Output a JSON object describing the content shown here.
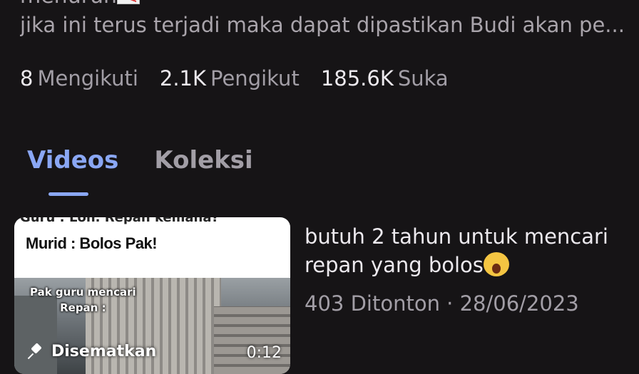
{
  "bio": {
    "line_partial": "menurun",
    "line2": "jika ini terus terjadi maka dapat dipastikan Budi akan pe..."
  },
  "stats": [
    {
      "num": "8",
      "label": "Mengikuti"
    },
    {
      "num": "2.1K",
      "label": "Pengikut"
    },
    {
      "num": "185.6K",
      "label": "Suka"
    }
  ],
  "tabs": {
    "videos": "Videos",
    "koleksi": "Koleksi"
  },
  "video": {
    "thumb_top_cut": "Guru : Loh. Repan kemana?",
    "thumb_caption1": "Murid : Bolos Pak!",
    "thumb_caption2": "Pak guru mencari",
    "thumb_caption3": "Repan :",
    "pinned_label": "Disematkan",
    "duration": "0:12",
    "title": "butuh 2 tahun untuk mencari repan yang bolos",
    "views": "403 Ditonton",
    "separator": "·",
    "date": "28/06/2023"
  },
  "colors": {
    "background": "#161416",
    "accent": "#8aa7f4",
    "muted_text": "#a29ea6"
  }
}
